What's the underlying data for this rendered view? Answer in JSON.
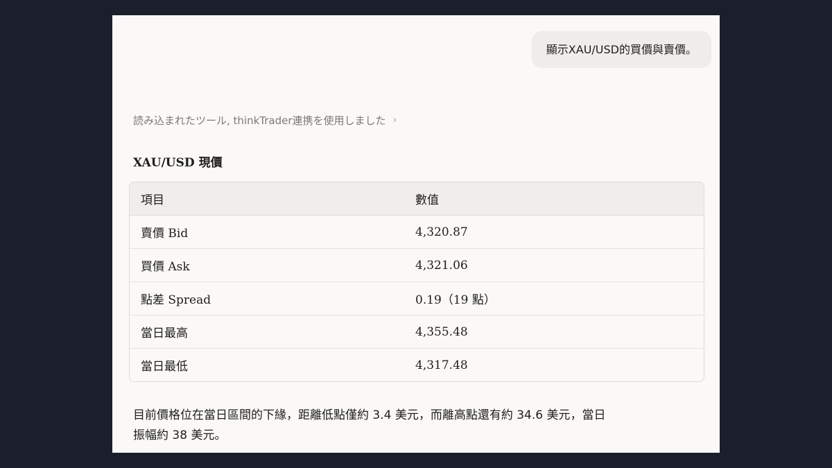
{
  "user_message": "顯示XAU/USD的買價與賣價。",
  "tool_status": {
    "text": "読み込まれたツール, thinkTrader連携を使用しました",
    "chevron": "›",
    "icon": "chevron-right-icon"
  },
  "heading": "XAU/USD 現價",
  "table": {
    "headers": [
      "項目",
      "數值"
    ],
    "rows": [
      [
        "賣價 Bid",
        "4,320.87"
      ],
      [
        "買價 Ask",
        "4,321.06"
      ],
      [
        "點差 Spread",
        "0.19（19 點）"
      ],
      [
        "當日最高",
        "4,355.48"
      ],
      [
        "當日最低",
        "4,317.48"
      ]
    ]
  },
  "summary": {
    "line1": "目前價格位在當日區間的下緣，距離低點僅約 3.4 美元，而離高點還有約 34.6 美元，當日",
    "line2": "振幅約 38 美元。"
  },
  "colors": {
    "background": "#1b1f2c",
    "panel": "#faf9f7",
    "bubble": "#efedea",
    "table_header": "#f0eeeb",
    "muted_text": "#7b7975"
  }
}
